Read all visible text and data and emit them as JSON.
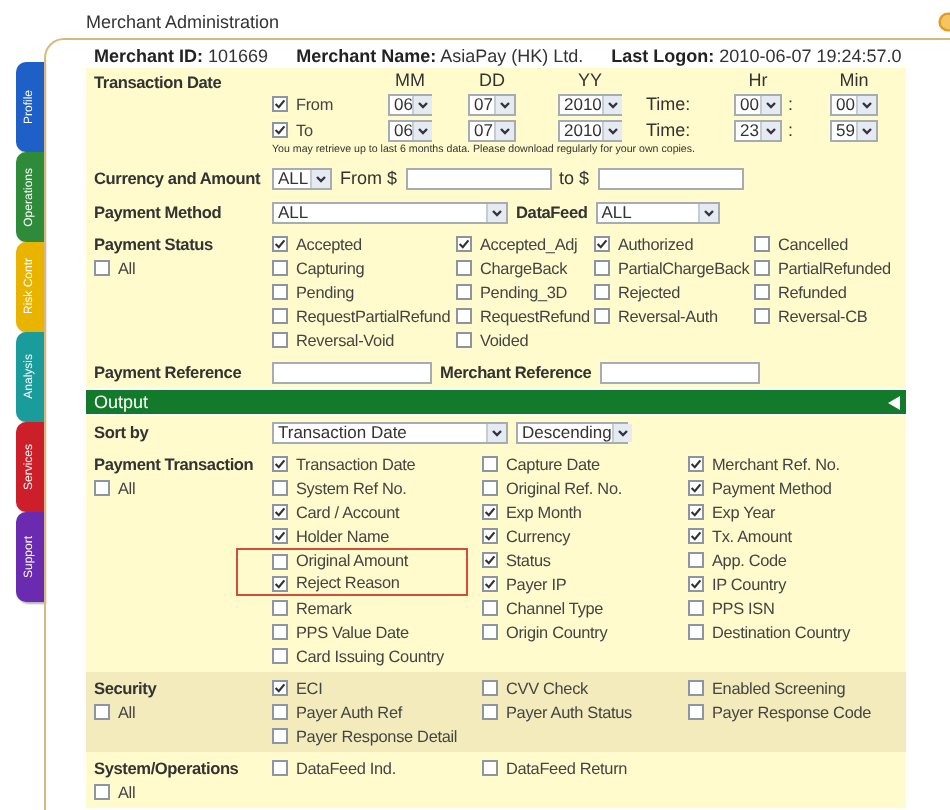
{
  "header": {
    "title": "Merchant Administration"
  },
  "side_tabs": [
    {
      "label": "Profile",
      "color": "#1f5fc8"
    },
    {
      "label": "Operations",
      "color": "#2e8b3a"
    },
    {
      "label": "Risk Contr",
      "color": "#e8b400"
    },
    {
      "label": "Analysis",
      "color": "#1a9c9c"
    },
    {
      "label": "Services",
      "color": "#cc1f2a"
    },
    {
      "label": "Support",
      "color": "#6a2bb0"
    }
  ],
  "merchant": [
    {
      "label": "Merchant ID:",
      "value": "101669"
    },
    {
      "label": "Merchant Name:",
      "value": "AsiaPay (HK) Ltd."
    },
    {
      "label": "Last Logon:",
      "value": "2010-06-07 19:24:57.0"
    }
  ],
  "transaction_date": {
    "label": "Transaction Date",
    "headers": [
      "MM",
      "DD",
      "YY",
      "Hr",
      "Min"
    ],
    "ranges": [
      {
        "label": "From",
        "checked": true,
        "month": "06",
        "day": "07",
        "year": "2010",
        "time_label": "Time:",
        "hour": "00",
        "separator": ":",
        "minute": "00"
      },
      {
        "label": "To",
        "checked": true,
        "month": "06",
        "day": "07",
        "year": "2010",
        "time_label": "Time:",
        "hour": "23",
        "separator": ":",
        "minute": "59"
      }
    ],
    "note": "You may retrieve up to last 6 months data. Please download regularly for your own copies."
  },
  "currency_amount": {
    "label": "Currency and Amount",
    "currency": "ALL",
    "from_label": "From $",
    "to_label": "to $"
  },
  "payment_method": {
    "label": "Payment Method",
    "value": "ALL",
    "datafeed_label": "DataFeed",
    "datafeed_value": "ALL"
  },
  "payment_status": {
    "label": "Payment Status",
    "all": {
      "label": "All",
      "checked": false
    },
    "rows": [
      [
        {
          "label": "Accepted",
          "checked": true
        },
        {
          "label": "Accepted_Adj",
          "checked": true
        },
        {
          "label": "Authorized",
          "checked": true
        },
        {
          "label": "Cancelled",
          "checked": false
        }
      ],
      [
        {
          "label": "Capturing",
          "checked": false
        },
        {
          "label": "ChargeBack",
          "checked": false
        },
        {
          "label": "PartialChargeBack",
          "checked": false
        },
        {
          "label": "PartialRefunded",
          "checked": false
        }
      ],
      [
        {
          "label": "Pending",
          "checked": false
        },
        {
          "label": "Pending_3D",
          "checked": false
        },
        {
          "label": "Rejected",
          "checked": false
        },
        {
          "label": "Refunded",
          "checked": false
        }
      ],
      [
        {
          "label": "RequestPartialRefund",
          "checked": false
        },
        {
          "label": "RequestRefund",
          "checked": false
        },
        {
          "label": "Reversal-Auth",
          "checked": false
        },
        {
          "label": "Reversal-CB",
          "checked": false
        }
      ],
      [
        {
          "label": "Reversal-Void",
          "checked": false
        },
        {
          "label": "Voided",
          "checked": false
        }
      ]
    ]
  },
  "references": {
    "payment_label": "Payment Reference",
    "merchant_label": "Merchant Reference"
  },
  "output": {
    "title": "Output"
  },
  "sort": {
    "label": "Sort by",
    "field": "Transaction Date",
    "order": "Descending"
  },
  "output_sections": [
    {
      "label": "Payment Transaction",
      "all": {
        "label": "All",
        "checked": false
      },
      "rows": [
        [
          {
            "label": "Transaction Date",
            "checked": true,
            "highlighted": false
          },
          {
            "label": "Capture Date",
            "checked": false,
            "highlighted": false
          },
          {
            "label": "Merchant Ref. No.",
            "checked": true,
            "highlighted": false
          }
        ],
        [
          {
            "label": "System Ref No.",
            "checked": false,
            "highlighted": false
          },
          {
            "label": "Original Ref. No.",
            "checked": false,
            "highlighted": false
          },
          {
            "label": "Payment Method",
            "checked": true,
            "highlighted": false
          }
        ],
        [
          {
            "label": "Card / Account",
            "checked": true,
            "highlighted": false
          },
          {
            "label": "Exp Month",
            "checked": true,
            "highlighted": false
          },
          {
            "label": "Exp Year",
            "checked": true,
            "highlighted": false
          }
        ],
        [
          {
            "label": "Holder Name",
            "checked": true,
            "highlighted": false
          },
          {
            "label": "Currency",
            "checked": true,
            "highlighted": false
          },
          {
            "label": "Tx. Amount",
            "checked": true,
            "highlighted": false
          }
        ],
        [
          {
            "label": "Original Amount",
            "checked": false,
            "highlighted": true
          },
          {
            "label": "Status",
            "checked": true,
            "highlighted": false
          },
          {
            "label": "App. Code",
            "checked": false,
            "highlighted": false
          }
        ],
        [
          {
            "label": "Reject Reason",
            "checked": true,
            "highlighted": true
          },
          {
            "label": "Payer IP",
            "checked": true,
            "highlighted": false
          },
          {
            "label": "IP Country",
            "checked": true,
            "highlighted": false
          }
        ],
        [
          {
            "label": "Remark",
            "checked": false,
            "highlighted": false
          },
          {
            "label": "Channel Type",
            "checked": false,
            "highlighted": false
          },
          {
            "label": "PPS ISN",
            "checked": false,
            "highlighted": false
          }
        ],
        [
          {
            "label": "PPS Value Date",
            "checked": false,
            "highlighted": false
          },
          {
            "label": "Origin Country",
            "checked": false,
            "highlighted": false
          },
          {
            "label": "Destination Country",
            "checked": false,
            "highlighted": false
          }
        ],
        [
          {
            "label": "Card Issuing Country",
            "checked": false,
            "highlighted": false
          }
        ]
      ]
    },
    {
      "label": "Security",
      "all": {
        "label": "All",
        "checked": false
      },
      "rows": [
        [
          {
            "label": "ECI",
            "checked": true
          },
          {
            "label": "CVV Check",
            "checked": false
          },
          {
            "label": "Enabled Screening",
            "checked": false
          }
        ],
        [
          {
            "label": "Payer Auth Ref",
            "checked": false
          },
          {
            "label": "Payer Auth Status",
            "checked": false
          },
          {
            "label": "Payer Response Code",
            "checked": false
          }
        ],
        [
          {
            "label": "Payer Response Detail",
            "checked": false
          }
        ]
      ]
    },
    {
      "label": "System/Operations",
      "all": {
        "label": "All",
        "checked": false
      },
      "rows": [
        [
          {
            "label": "DataFeed Ind.",
            "checked": false
          },
          {
            "label": "DataFeed Return",
            "checked": false
          }
        ]
      ]
    }
  ]
}
